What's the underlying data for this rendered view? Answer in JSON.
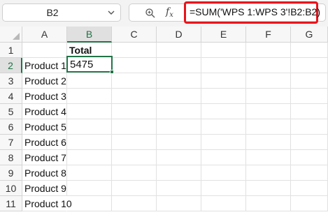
{
  "formula_bar": {
    "name_box": "B2",
    "formula": "=SUM('WPS 1:WPS 3'!B2:B2)",
    "fx_label": "f",
    "fx_sub": "x"
  },
  "columns": [
    "A",
    "B",
    "C",
    "D",
    "E",
    "F",
    "G"
  ],
  "rows": [
    "1",
    "2",
    "3",
    "4",
    "5",
    "6",
    "7",
    "8",
    "9",
    "10",
    "11"
  ],
  "cells": {
    "B1": "Total",
    "B2": "5475",
    "A2": "Product 1",
    "A3": "Product 2",
    "A4": "Product 3",
    "A5": "Product 4",
    "A6": "Product 5",
    "A7": "Product 6",
    "A8": "Product 7",
    "A9": "Product 8",
    "A10": "Product 9",
    "A11": "Product 10"
  },
  "colors": {
    "accent": "#217346",
    "highlight": "#e8141c"
  }
}
